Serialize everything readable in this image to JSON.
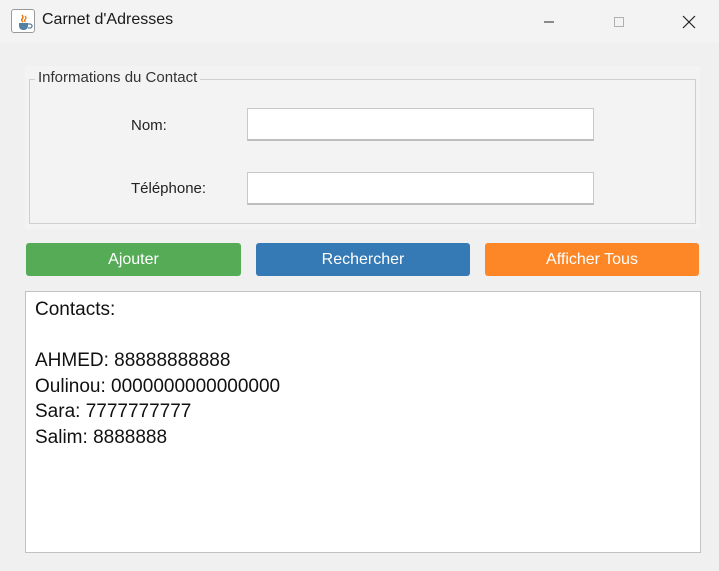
{
  "window": {
    "title": "Carnet d'Adresses",
    "icon": "java-cup-icon",
    "controls": [
      "minimize-icon",
      "maximize-icon",
      "close-icon"
    ]
  },
  "form": {
    "legend": "Informations du Contact",
    "name_label": "Nom:",
    "name_value": "",
    "phone_label": "Téléphone:",
    "phone_value": ""
  },
  "buttons": {
    "add": {
      "label": "Ajouter",
      "color": "#55ab56"
    },
    "search": {
      "label": "Rechercher",
      "color": "#3579b5"
    },
    "show_all": {
      "label": "Afficher Tous",
      "color": "#fd8726"
    }
  },
  "results": {
    "header": "Contacts:",
    "blank": "",
    "contacts": [
      "AHMED: 88888888888",
      "Oulinou: 0000000000000000",
      "Sara: 7777777777",
      "Salim: 8888888"
    ]
  }
}
